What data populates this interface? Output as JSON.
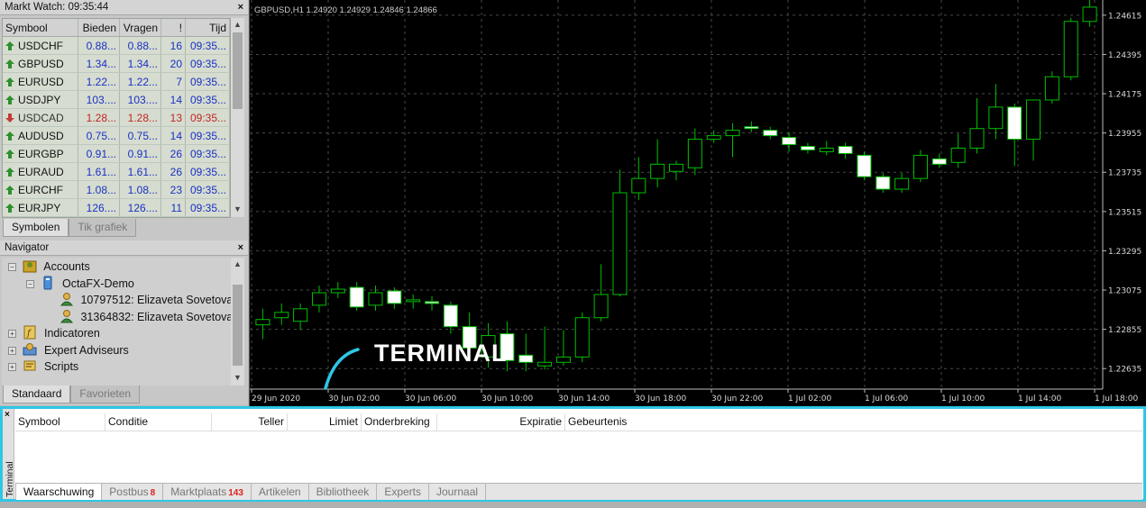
{
  "market_watch": {
    "title": "Markt Watch: 09:35:44",
    "close": "×",
    "columns": {
      "symbol": "Symbool",
      "bid": "Bieden",
      "ask": "Vragen",
      "spread": "!",
      "time": "Tijd"
    },
    "rows": [
      {
        "symbol": "USDCHF",
        "bid": "0.88...",
        "ask": "0.88...",
        "spread": "16",
        "time": "09:35...",
        "dir": "up"
      },
      {
        "symbol": "GBPUSD",
        "bid": "1.34...",
        "ask": "1.34...",
        "spread": "20",
        "time": "09:35...",
        "dir": "up"
      },
      {
        "symbol": "EURUSD",
        "bid": "1.22...",
        "ask": "1.22...",
        "spread": "7",
        "time": "09:35...",
        "dir": "up"
      },
      {
        "symbol": "USDJPY",
        "bid": "103....",
        "ask": "103....",
        "spread": "14",
        "time": "09:35...",
        "dir": "up"
      },
      {
        "symbol": "USDCAD",
        "bid": "1.28...",
        "ask": "1.28...",
        "spread": "13",
        "time": "09:35...",
        "dir": "down"
      },
      {
        "symbol": "AUDUSD",
        "bid": "0.75...",
        "ask": "0.75...",
        "spread": "14",
        "time": "09:35...",
        "dir": "up"
      },
      {
        "symbol": "EURGBP",
        "bid": "0.91...",
        "ask": "0.91...",
        "spread": "26",
        "time": "09:35...",
        "dir": "up"
      },
      {
        "symbol": "EURAUD",
        "bid": "1.61...",
        "ask": "1.61...",
        "spread": "26",
        "time": "09:35...",
        "dir": "up"
      },
      {
        "symbol": "EURCHF",
        "bid": "1.08...",
        "ask": "1.08...",
        "spread": "23",
        "time": "09:35...",
        "dir": "up"
      },
      {
        "symbol": "EURJPY",
        "bid": "126....",
        "ask": "126....",
        "spread": "11",
        "time": "09:35...",
        "dir": "up"
      }
    ],
    "tabs": [
      "Symbolen",
      "Tik grafiek"
    ]
  },
  "navigator": {
    "title": "Navigator",
    "close": "×",
    "accounts": "Accounts",
    "server": "OctaFX-Demo",
    "account1": "10797512: Elizaveta Sovetova",
    "account2": "31364832: Elizaveta Sovetova",
    "indicators": "Indicatoren",
    "experts": "Expert Adviseurs",
    "scripts": "Scripts",
    "tabs": [
      "Standaard",
      "Favorieten"
    ]
  },
  "chart": {
    "info": "GBPUSD,H1  1.24920 1.24929 1.24846 1.24866",
    "overlay_label": "TERMINAL",
    "colors": {
      "bull": "#000000",
      "bear": "#ffffff",
      "wick": "#00c000",
      "grid": "#4a4a4a",
      "axis_text": "#d8d8d8"
    }
  },
  "chart_data": {
    "type": "candlestick",
    "symbol": "GBPUSD",
    "timeframe": "H1",
    "ylim": [
      1.2252,
      1.247
    ],
    "y_ticks": [
      "1.24615",
      "1.24395",
      "1.24175",
      "1.23955",
      "1.23735",
      "1.23515",
      "1.23295",
      "1.23075",
      "1.22855",
      "1.22635"
    ],
    "x_ticks": [
      "29 Jun 2020",
      "30 Jun 02:00",
      "30 Jun 06:00",
      "30 Jun 10:00",
      "30 Jun 14:00",
      "30 Jun 18:00",
      "30 Jun 22:00",
      "1 Jul 02:00",
      "1 Jul 06:00",
      "1 Jul 10:00",
      "1 Jul 14:00",
      "1 Jul 18:00"
    ],
    "candles": [
      {
        "o": 1.2288,
        "h": 1.2297,
        "l": 1.228,
        "c": 1.2291
      },
      {
        "o": 1.2292,
        "h": 1.23,
        "l": 1.2288,
        "c": 1.2295
      },
      {
        "o": 1.229,
        "h": 1.23,
        "l": 1.2285,
        "c": 1.2297
      },
      {
        "o": 1.2299,
        "h": 1.231,
        "l": 1.2295,
        "c": 1.2306
      },
      {
        "o": 1.2306,
        "h": 1.2312,
        "l": 1.2303,
        "c": 1.2308
      },
      {
        "o": 1.2309,
        "h": 1.2312,
        "l": 1.2296,
        "c": 1.2298
      },
      {
        "o": 1.2299,
        "h": 1.231,
        "l": 1.2296,
        "c": 1.2306
      },
      {
        "o": 1.2307,
        "h": 1.2309,
        "l": 1.2297,
        "c": 1.23
      },
      {
        "o": 1.2301,
        "h": 1.2305,
        "l": 1.2297,
        "c": 1.2302
      },
      {
        "o": 1.2301,
        "h": 1.2304,
        "l": 1.2296,
        "c": 1.23
      },
      {
        "o": 1.2299,
        "h": 1.2301,
        "l": 1.2283,
        "c": 1.2287
      },
      {
        "o": 1.2287,
        "h": 1.2295,
        "l": 1.227,
        "c": 1.2275
      },
      {
        "o": 1.227,
        "h": 1.2289,
        "l": 1.2264,
        "c": 1.2282
      },
      {
        "o": 1.2283,
        "h": 1.229,
        "l": 1.2262,
        "c": 1.2268
      },
      {
        "o": 1.2271,
        "h": 1.2283,
        "l": 1.2262,
        "c": 1.2267
      },
      {
        "o": 1.2265,
        "h": 1.2287,
        "l": 1.2263,
        "c": 1.2267
      },
      {
        "o": 1.2267,
        "h": 1.2285,
        "l": 1.2265,
        "c": 1.227
      },
      {
        "o": 1.227,
        "h": 1.2295,
        "l": 1.2267,
        "c": 1.2292
      },
      {
        "o": 1.2292,
        "h": 1.2322,
        "l": 1.229,
        "c": 1.2305
      },
      {
        "o": 1.2305,
        "h": 1.2375,
        "l": 1.2304,
        "c": 1.2362
      },
      {
        "o": 1.2362,
        "h": 1.2382,
        "l": 1.2358,
        "c": 1.237
      },
      {
        "o": 1.237,
        "h": 1.2392,
        "l": 1.2365,
        "c": 1.2378
      },
      {
        "o": 1.2374,
        "h": 1.238,
        "l": 1.2369,
        "c": 1.2378
      },
      {
        "o": 1.2376,
        "h": 1.2398,
        "l": 1.2372,
        "c": 1.2392
      },
      {
        "o": 1.2392,
        "h": 1.2397,
        "l": 1.239,
        "c": 1.2394
      },
      {
        "o": 1.2394,
        "h": 1.2401,
        "l": 1.2382,
        "c": 1.2397
      },
      {
        "o": 1.2399,
        "h": 1.2402,
        "l": 1.2396,
        "c": 1.2398
      },
      {
        "o": 1.2397,
        "h": 1.2399,
        "l": 1.2392,
        "c": 1.2394
      },
      {
        "o": 1.2393,
        "h": 1.2396,
        "l": 1.2385,
        "c": 1.2389
      },
      {
        "o": 1.2388,
        "h": 1.239,
        "l": 1.2384,
        "c": 1.2386
      },
      {
        "o": 1.2385,
        "h": 1.2391,
        "l": 1.2383,
        "c": 1.2387
      },
      {
        "o": 1.2388,
        "h": 1.239,
        "l": 1.2381,
        "c": 1.2384
      },
      {
        "o": 1.2383,
        "h": 1.2385,
        "l": 1.2369,
        "c": 1.2371
      },
      {
        "o": 1.2371,
        "h": 1.2373,
        "l": 1.2362,
        "c": 1.2364
      },
      {
        "o": 1.2364,
        "h": 1.2373,
        "l": 1.2362,
        "c": 1.237
      },
      {
        "o": 1.237,
        "h": 1.2386,
        "l": 1.2368,
        "c": 1.2383
      },
      {
        "o": 1.2381,
        "h": 1.2384,
        "l": 1.2376,
        "c": 1.2378
      },
      {
        "o": 1.2379,
        "h": 1.2395,
        "l": 1.2376,
        "c": 1.2387
      },
      {
        "o": 1.2387,
        "h": 1.2415,
        "l": 1.2384,
        "c": 1.2398
      },
      {
        "o": 1.2398,
        "h": 1.2423,
        "l": 1.2392,
        "c": 1.241
      },
      {
        "o": 1.241,
        "h": 1.2412,
        "l": 1.2377,
        "c": 1.2392
      },
      {
        "o": 1.2392,
        "h": 1.2414,
        "l": 1.238,
        "c": 1.2414
      },
      {
        "o": 1.2414,
        "h": 1.243,
        "l": 1.2412,
        "c": 1.2427
      },
      {
        "o": 1.2427,
        "h": 1.246,
        "l": 1.2425,
        "c": 1.2458
      },
      {
        "o": 1.2458,
        "h": 1.247,
        "l": 1.2455,
        "c": 1.2466
      }
    ]
  },
  "terminal": {
    "side_label": "Terminal",
    "close": "×",
    "columns": {
      "symbol": "Symbool",
      "condition": "Conditie",
      "counter": "Teller",
      "limit": "Limiet",
      "interrupt": "Onderbreking",
      "expiration": "Expiratie",
      "event": "Gebeurtenis"
    },
    "tabs": {
      "alerts": "Waarschuwing",
      "mailbox": "Postbus",
      "mailbox_count": "8",
      "market": "Marktplaats",
      "market_count": "143",
      "articles": "Artikelen",
      "library": "Bibliotheek",
      "experts": "Experts",
      "journal": "Journaal"
    }
  }
}
